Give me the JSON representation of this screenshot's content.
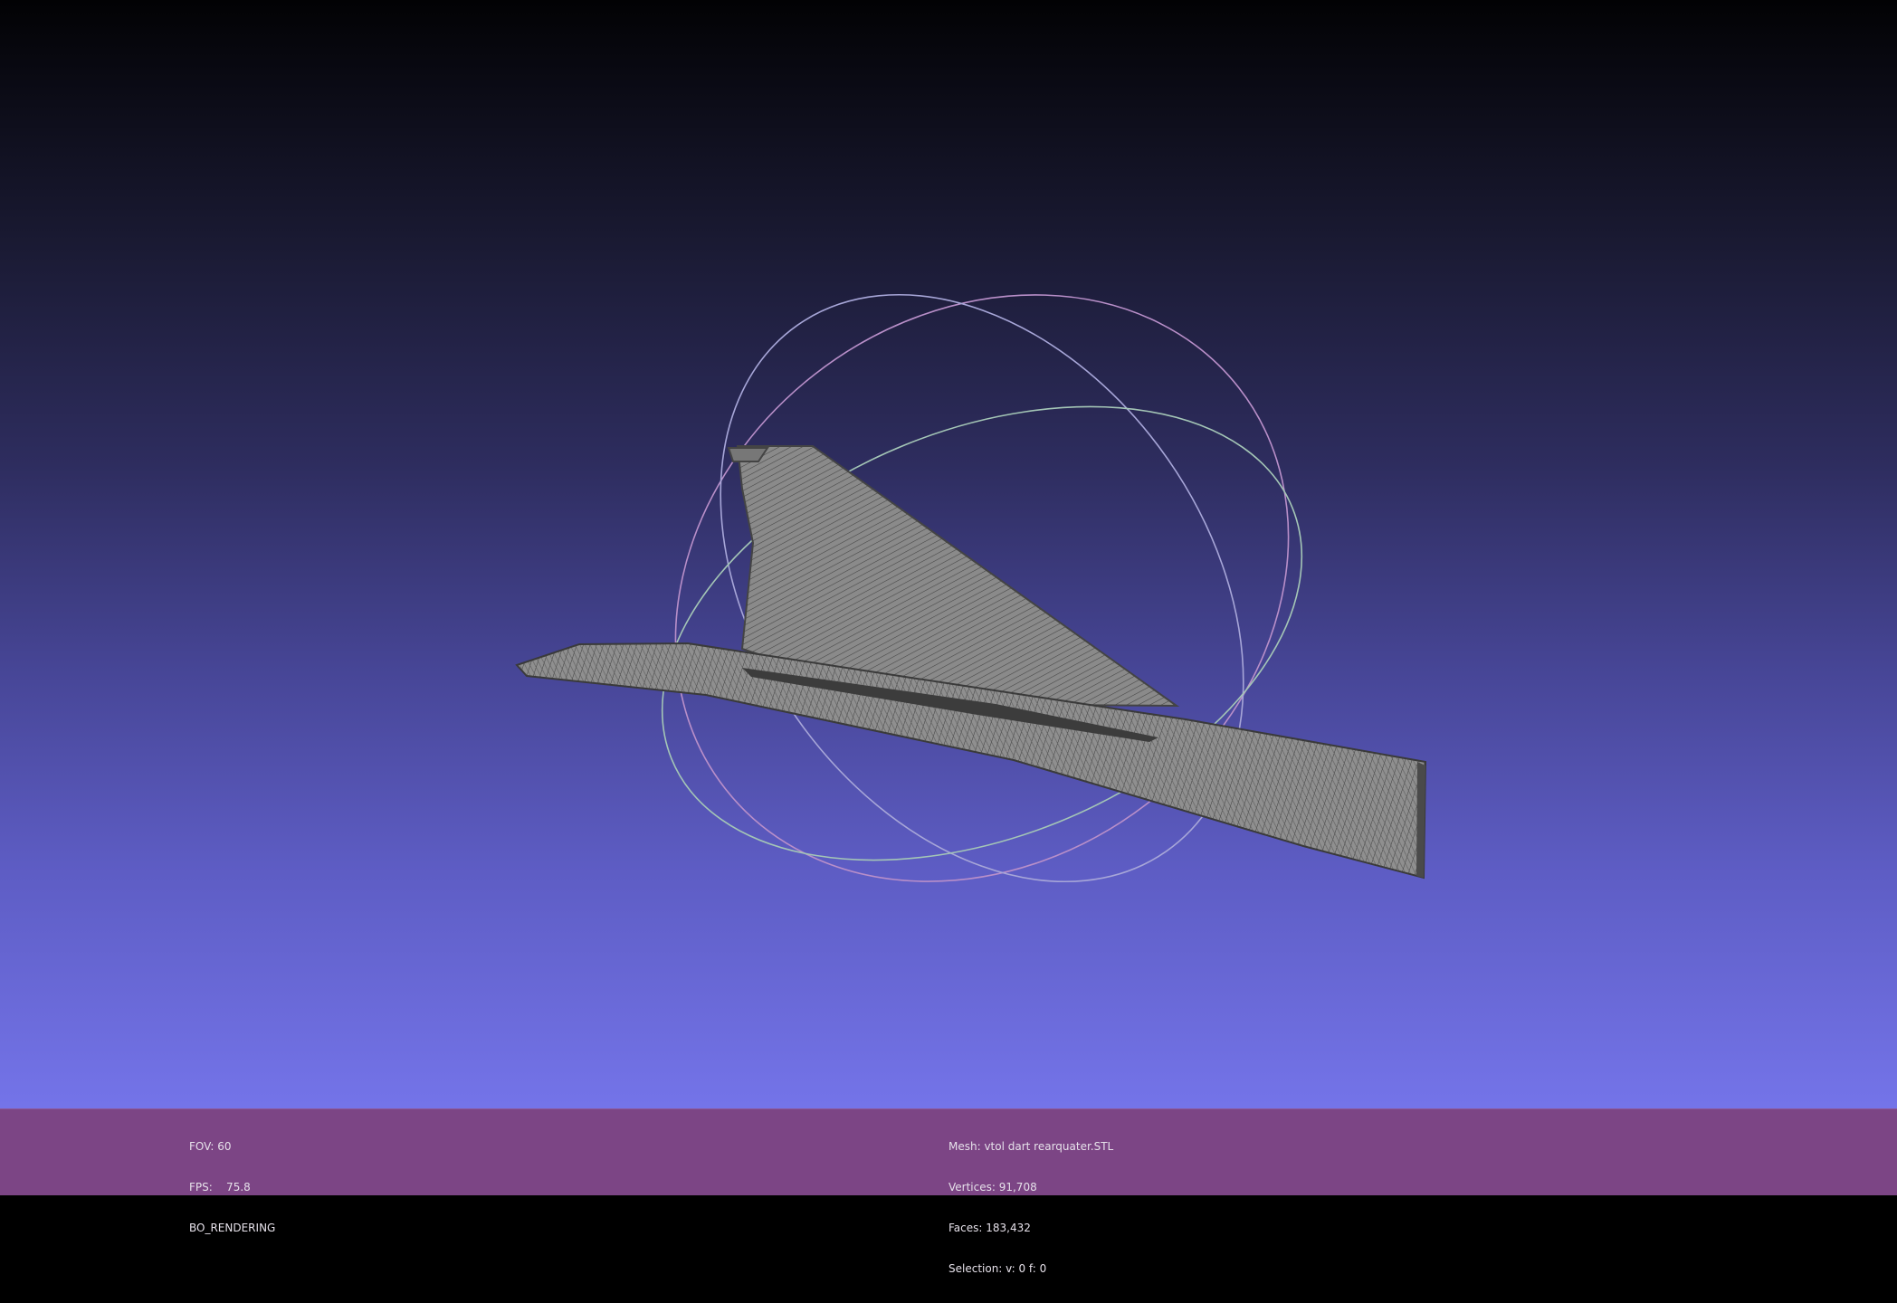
{
  "viewer": {
    "background_top": "#020204",
    "background_bottom": "#7474e9",
    "mesh_color": "#8c8c8c",
    "wire_color": "#3a3a3a",
    "trackball_colors": [
      "#c79ac8",
      "#9c9fd6",
      "#9bcfa2"
    ]
  },
  "info_bar": {
    "color": "#7c4585",
    "left": {
      "fov": "FOV: 60",
      "fps": "FPS:    75.8",
      "render_mode": "BO_RENDERING"
    },
    "right": {
      "mesh": "Mesh: vtol dart rearquater.STL",
      "vertices": "Vertices: 91,708",
      "faces": "Faces: 183,432",
      "selection": "Selection: v: 0 f: 0"
    }
  }
}
